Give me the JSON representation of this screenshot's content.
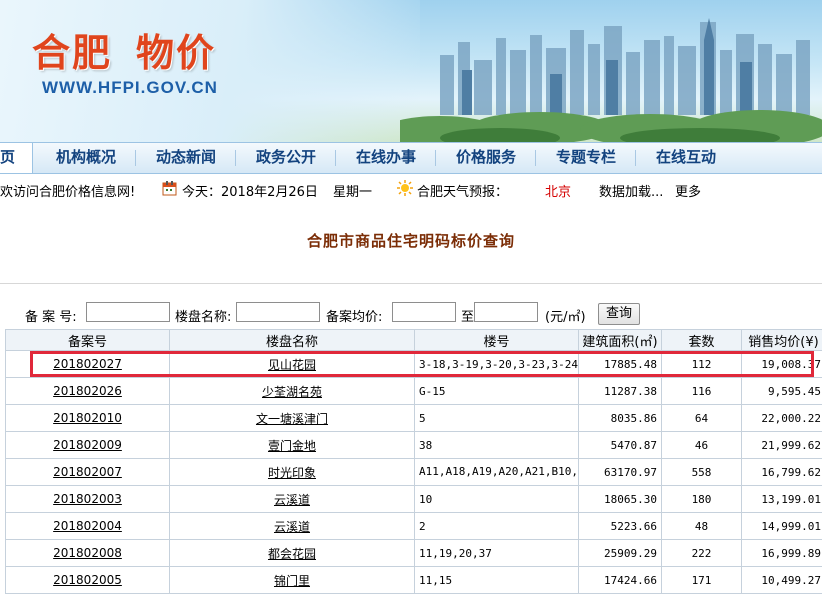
{
  "banner": {
    "logo_text_1": "合肥",
    "logo_text_2": "物价",
    "site_url": "WWW.HFPI.GOV.CN"
  },
  "nav": {
    "items": [
      "页",
      "机构概况",
      "动态新闻",
      "政务公开",
      "在线办事",
      "价格服务",
      "专题专栏",
      "在线互动"
    ]
  },
  "infobar": {
    "welcome": "欢访问合肥价格信息网!",
    "date": "今天：2018年2月26日",
    "weekday": "星期一",
    "weather_label": "合肥天气预报：",
    "city": "北京",
    "loading": "数据加载...",
    "more": "更多"
  },
  "page_title": "合肥市商品住宅明码标价查询",
  "search": {
    "record_no_label": "备 案 号:",
    "project_name_label": "楼盘名称:",
    "avg_price_label": "备案均价:",
    "to_label": "至",
    "unit_label": "(元/㎡)",
    "submit_label": "查询"
  },
  "table": {
    "headers": [
      "备案号",
      "楼盘名称",
      "楼号",
      "建筑面积(㎡)",
      "套数",
      "销售均价(¥)"
    ],
    "rows": [
      [
        "201802027",
        "见山花园",
        "3-18,3-19,3-20,3-23,3-24",
        "17885.48",
        "112",
        "19,008.37"
      ],
      [
        "201802026",
        "少荃湖名苑",
        "G-15",
        "11287.38",
        "116",
        "9,595.45"
      ],
      [
        "201802010",
        "文一塘溪津门",
        "5",
        "8035.86",
        "64",
        "22,000.22"
      ],
      [
        "201802009",
        "壹门金地",
        "38",
        "5470.87",
        "46",
        "21,999.62"
      ],
      [
        "201802007",
        "时光印象",
        "A11,A18,A19,A20,A21,B10,B11",
        "63170.97",
        "558",
        "16,799.62"
      ],
      [
        "201802003",
        "云溪道",
        "10",
        "18065.30",
        "180",
        "13,199.01"
      ],
      [
        "201802004",
        "云溪道",
        "2",
        "5223.66",
        "48",
        "14,999.01"
      ],
      [
        "201802008",
        "都会花园",
        "11,19,20,37",
        "25909.29",
        "222",
        "16,999.89"
      ],
      [
        "201802005",
        "锦门里",
        "11,15",
        "17424.66",
        "171",
        "10,499.27"
      ]
    ]
  },
  "colors": {
    "logo": "#e0451d",
    "nav_text": "#13437f",
    "title": "#7b2d06",
    "highlight": "#e0283a"
  }
}
